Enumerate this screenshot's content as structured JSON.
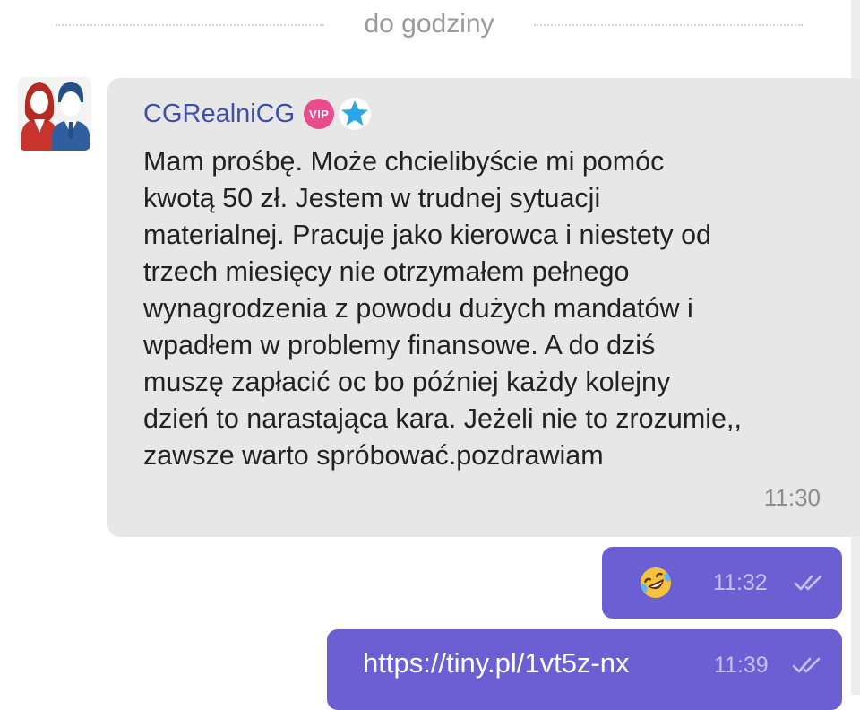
{
  "date_separator": "do godziny",
  "incoming": {
    "avatar_icon": "couple-avatar-icon",
    "sender_name": "CGRealniCG",
    "vip_badge": "VIP",
    "star_icon": "blue-star-icon",
    "text": "Mam prośbę. Może chcielibyście mi pomóc\nkwotą 50 zł. Jestem w trudnej sytuacji\nmaterialnej. Pracuje jako kierowca i niestety od\ntrzech miesięcy nie otrzymałem pełnego\nwynagrodzenia z powodu dużych mandatów i\nwpadłem w problemy finansowe. A do dziś\nmuszę zapłacić oc bo później każdy kolejny\ndzień to narastająca kara. Jeżeli nie to zrozumie,,\nzawsze warto spróbować.pozdrawiam",
    "time": "11:30"
  },
  "outgoing": [
    {
      "emoji_icon": "rolling-on-floor-laughing-emoji-icon",
      "time": "11:32",
      "status_icon": "double-check-icon"
    },
    {
      "text": "https://tiny.pl/1vt5z-nx",
      "time": "11:39",
      "status_icon": "double-check-icon"
    }
  ],
  "colors": {
    "incoming_bubble": "#e7e7e7",
    "outgoing_bubble": "#6c5fd4",
    "sender_name": "#3e4fa8",
    "vip_badge": "#e84c8c",
    "star": "#29a7ea"
  }
}
